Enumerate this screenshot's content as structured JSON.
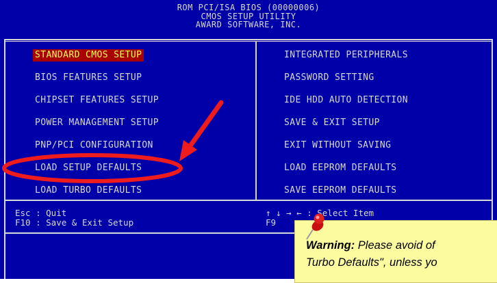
{
  "header": {
    "line1": "ROM PCI/ISA BIOS (00000006)",
    "line2": "CMOS SETUP UTILITY",
    "line3": "AWARD SOFTWARE, INC."
  },
  "menu": {
    "left": [
      {
        "label": "STANDARD CMOS SETUP",
        "selected": true
      },
      {
        "label": "BIOS FEATURES SETUP"
      },
      {
        "label": "CHIPSET FEATURES SETUP"
      },
      {
        "label": "POWER MANAGEMENT SETUP"
      },
      {
        "label": "PNP/PCI CONFIGURATION"
      },
      {
        "label": "LOAD SETUP DEFAULTS"
      },
      {
        "label": "LOAD TURBO DEFAULTS"
      }
    ],
    "right": [
      {
        "label": "INTEGRATED PERIPHERALS"
      },
      {
        "label": "PASSWORD SETTING"
      },
      {
        "label": "IDE HDD AUTO DETECTION"
      },
      {
        "label": "SAVE & EXIT SETUP"
      },
      {
        "label": "EXIT WITHOUT SAVING"
      },
      {
        "label": "LOAD EEPROM DEFAULTS"
      },
      {
        "label": "SAVE EEPROM DEFAULTS"
      }
    ]
  },
  "help": {
    "left_line1": "Esc : Quit",
    "left_line2": "F10 : Save & Exit Setup",
    "right_line1": "↑ ↓ → ← : Select Item",
    "right_line2": "F9"
  },
  "warning": {
    "label": "Warning:",
    "line1_rest": " Please avoid of",
    "line2": "Turbo Defaults\", unless yo"
  },
  "colors": {
    "screen_bg": "#0000a8",
    "text": "#d8d8d8",
    "selected_bg": "#a80000",
    "selected_text": "#ffff55",
    "annotation": "#ee1c1c",
    "note_bg": "#fdfba0"
  },
  "icons": {
    "annotation_arrow": "red-arrow-icon",
    "annotation_circle": "red-ellipse-highlight",
    "note_pin": "pushpin-icon"
  }
}
